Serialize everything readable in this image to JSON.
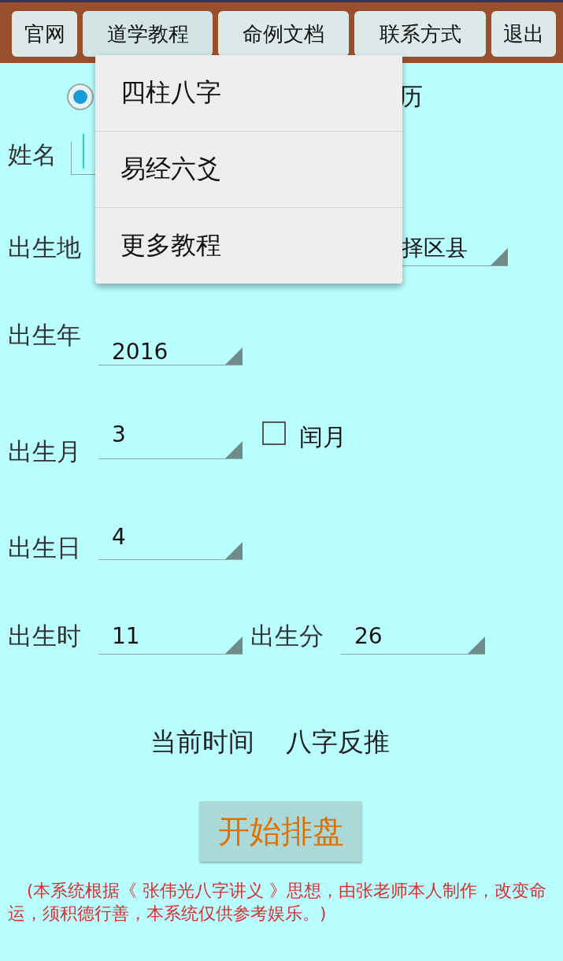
{
  "top_buttons": [
    {
      "label": "官网"
    },
    {
      "label": "道学教程",
      "selected": true
    },
    {
      "label": "命例文档"
    },
    {
      "label": "联系方式"
    },
    {
      "label": "退出"
    }
  ],
  "menu": {
    "items": [
      {
        "label": "四柱八字"
      },
      {
        "label": "易经六爻"
      },
      {
        "label": "更多教程"
      }
    ]
  },
  "calendar": {
    "selected": true,
    "label_fragment": "历"
  },
  "name": {
    "label": "姓名"
  },
  "birthplace": {
    "label": "出生地",
    "value": "择区县"
  },
  "year": {
    "label": "出生年",
    "value": "2016"
  },
  "month": {
    "label": "出生月",
    "value": "3",
    "leap": {
      "label": "闰月",
      "checked": false
    }
  },
  "day": {
    "label": "出生日",
    "value": "4"
  },
  "hour": {
    "label": "出生时",
    "value": "11"
  },
  "minute": {
    "label": "出生分",
    "value": "26"
  },
  "actions": [
    {
      "label": "当前时间"
    },
    {
      "label": "八字反推"
    }
  ],
  "start_button": {
    "label": "开始排盘"
  },
  "disclaimer": "(本系统根据《 张伟光八字讲义 》思想，由张老师本人制作，改变命运，须积德行善，本系统仅供参考娱乐。)"
}
